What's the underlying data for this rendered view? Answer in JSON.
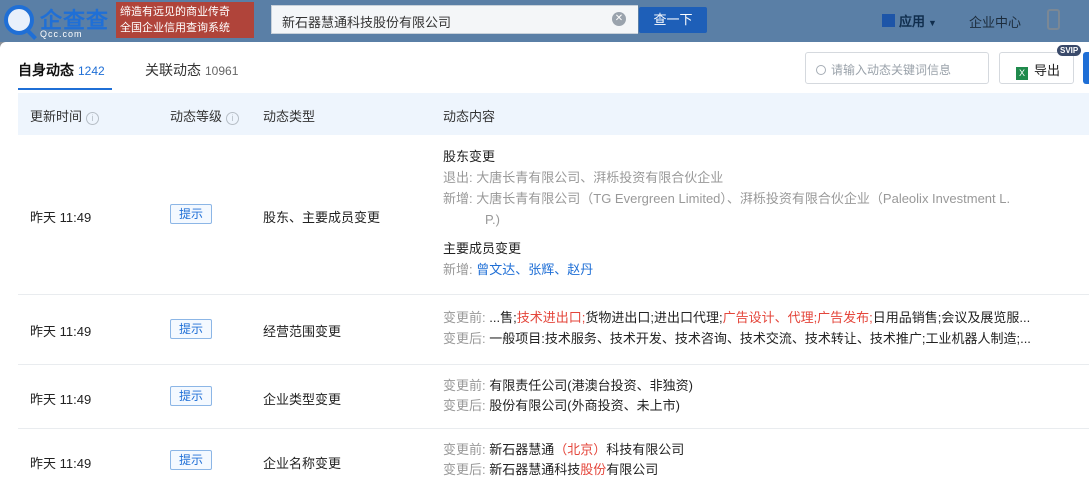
{
  "header": {
    "logo_text": "企查查",
    "logo_sub": "Qcc.com",
    "slogan_line1": "缔造有远见的商业传奇",
    "slogan_line2": "全国企业信用查询系统",
    "search_value": "新石器慧通科技股份有限公司",
    "search_button": "查一下",
    "apps_label": "应用",
    "enterprise_center": "企业中心"
  },
  "tabs": {
    "self_label": "自身动态",
    "self_count": "1242",
    "related_label": "关联动态",
    "related_count": "10961"
  },
  "toolbar": {
    "search_placeholder": "请输入动态关键词信息",
    "export_label": "导出",
    "svip_badge": "SVIP"
  },
  "table": {
    "headers": {
      "time": "更新时间",
      "level": "动态等级",
      "type": "动态类型",
      "content": "动态内容"
    },
    "rows": [
      {
        "time": "昨天 11:49",
        "level": "提示",
        "type": "股东、主要成员变更",
        "section1_title": "股东变更",
        "exit_label": "退出:",
        "exit_value": "大唐长青有限公司、湃栎投资有限合伙企业",
        "add_label": "新增:",
        "add_value_1": "大唐长青有限公司（TG Evergreen Limited）、湃栎投资有限合伙企业（Paleolix Investment L.",
        "add_value_2": "P.)",
        "section2_title": "主要成员变更",
        "members_label": "新增:",
        "members": "曾文达、张辉、赵丹"
      },
      {
        "time": "昨天 11:49",
        "level": "提示",
        "type": "经营范围变更",
        "before_label": "变更前:",
        "before_p1": "...售;",
        "before_p2": "技术进出口;",
        "before_p3": "货物进出口;进出口代理;",
        "before_p4": "广告设计、代理;广告发布;",
        "before_p5": "日用品销售;会议及展览服...",
        "after_label": "变更后:",
        "after_value": "一般项目:技术服务、技术开发、技术咨询、技术交流、技术转让、技术推广;工业机器人制造;..."
      },
      {
        "time": "昨天 11:49",
        "level": "提示",
        "type": "企业类型变更",
        "before_label": "变更前:",
        "before_value": "有限责任公司(港澳台投资、非独资)",
        "after_label": "变更后:",
        "after_value": "股份有限公司(外商投资、未上市)"
      },
      {
        "time": "昨天 11:49",
        "level": "提示",
        "type": "企业名称变更",
        "before_label": "变更前:",
        "before_p1": "新石器慧通",
        "before_p2": "（北京）",
        "before_p3": "科技有限公司",
        "after_label": "变更后:",
        "after_p1": "新石器慧通科技",
        "after_p2": "股份",
        "after_p3": "有限公司"
      }
    ]
  },
  "colors": {
    "accent": "#1f6fd6",
    "highlight_red": "#e4463b",
    "header_bg": "#eef5fd"
  }
}
